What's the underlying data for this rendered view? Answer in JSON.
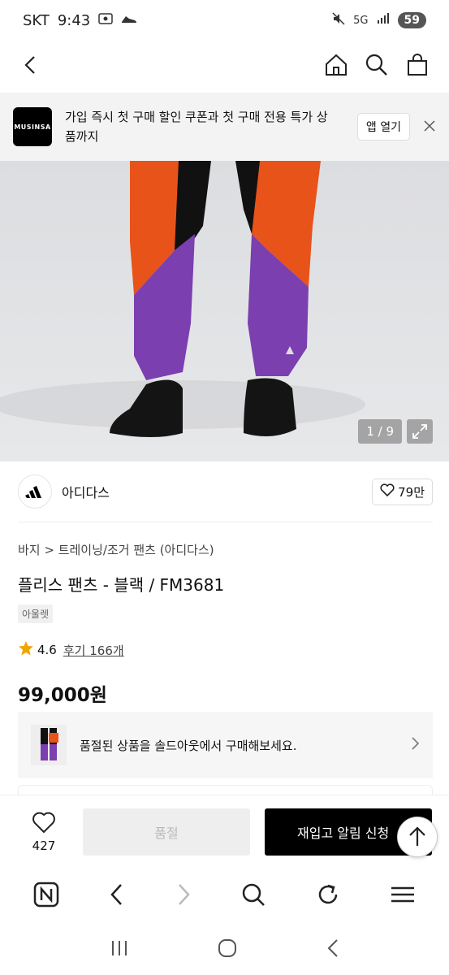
{
  "status_bar": {
    "carrier": "SKT",
    "time": "9:43",
    "network": "5G",
    "battery": "59"
  },
  "banner": {
    "logo_text": "MUSINSA",
    "message": "가입 즉시 첫 구매 할인 쿠폰과 첫 구매 전용 특가 상품까지",
    "open_label": "앱 열기"
  },
  "gallery": {
    "counter": "1 / 9"
  },
  "brand": {
    "name": "아디다스",
    "likes": "79만"
  },
  "product": {
    "breadcrumb": "바지 > 트레이닝/조거 팬츠 (아디다스)",
    "title": "플리스 팬츠 - 블랙 / FM3681",
    "tag": "아울렛",
    "rating": "4.6",
    "reviews": "후기 166개",
    "price": "99,000원"
  },
  "soldout": {
    "message": "품절된 상품을 솔드아웃에서 구매해보세요."
  },
  "actions": {
    "like_count": "427",
    "soldout_label": "품절",
    "restock_label": "재입고 알림 신청"
  },
  "colors": {
    "orange": "#e8531a",
    "purple": "#7b3fb0",
    "black": "#000000"
  }
}
